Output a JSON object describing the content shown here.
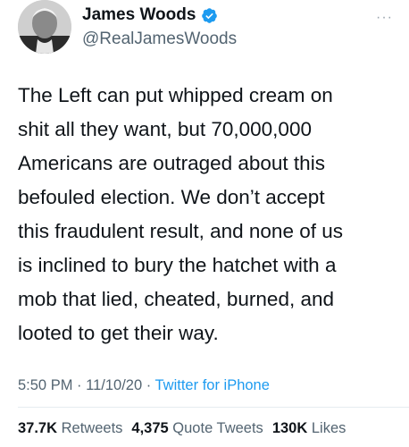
{
  "user": {
    "display_name": "James Woods",
    "handle": "@RealJamesWoods",
    "verified": true
  },
  "more_icon": "···",
  "tweet": {
    "lines": [
      "The Left can put whipped cream on",
      "shit all they want, but 70,000,000",
      "Americans are outraged about this",
      "befouled election. We don’t accept",
      "this fraudulent result, and none of us",
      "is inclined to bury the hatchet with a",
      "mob that lied, cheated, burned, and",
      "looted to get their way."
    ]
  },
  "meta": {
    "time": "5:50 PM",
    "sep1": " · ",
    "date": "11/10/20",
    "sep2": " · ",
    "source": "Twitter for iPhone"
  },
  "stats": {
    "retweets_count": "37.7K",
    "retweets_label": "Retweets",
    "quotes_count": "4,375",
    "quotes_label": "Quote Tweets",
    "likes_count": "130K",
    "likes_label": "Likes"
  },
  "colors": {
    "text": "#0f1419",
    "secondary": "#536471",
    "link": "#1d9bf0",
    "verified": "#1d9bf0"
  }
}
